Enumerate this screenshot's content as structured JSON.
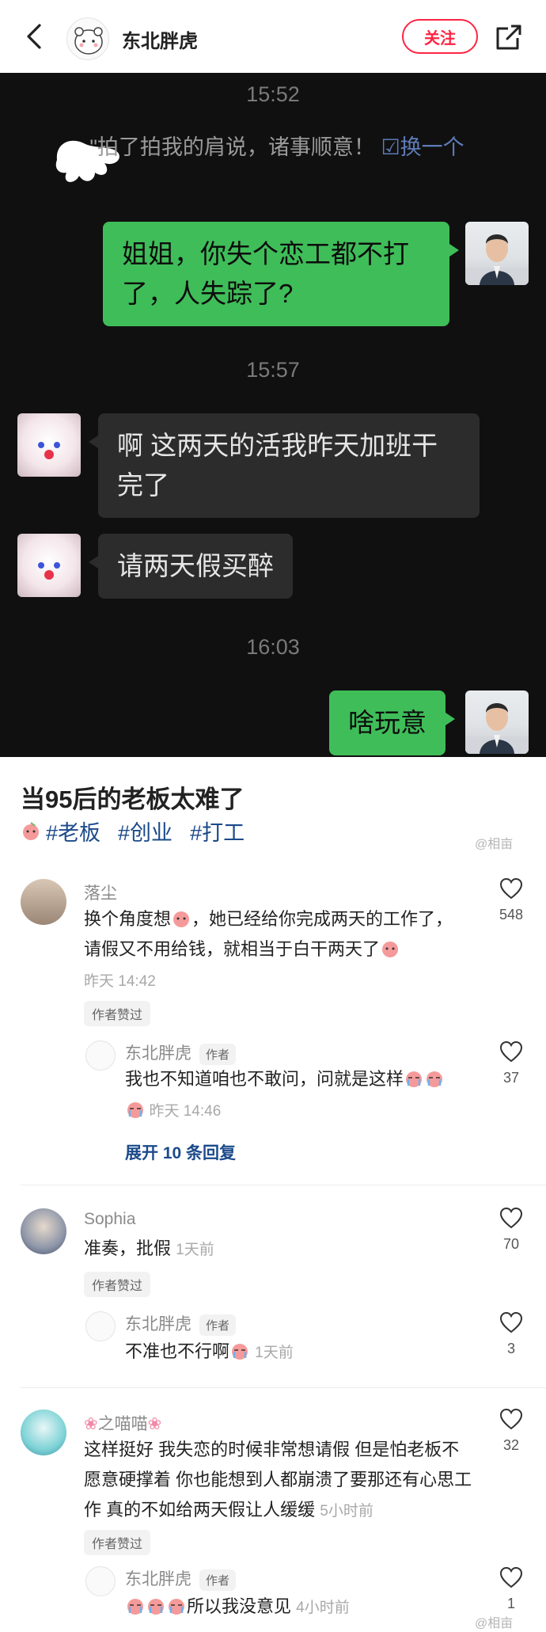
{
  "header": {
    "author_name": "东北胖虎",
    "follow_label": "关注",
    "icons": {
      "back": "back-arrow-icon",
      "share": "share-icon"
    }
  },
  "chat": {
    "times": [
      "15:52",
      "15:57",
      "16:03"
    ],
    "system_text": "\"拍了拍我的肩说，诸事顺意！",
    "system_link": "☑换一个",
    "messages": [
      {
        "from": "me",
        "text": "姐姐，你失个恋工都不打了，人失踪了?"
      },
      {
        "from": "them",
        "text": "啊 这两天的活我昨天加班干完了"
      },
      {
        "from": "them",
        "text": "请两天假买醉"
      },
      {
        "from": "me",
        "text": "啥玩意"
      }
    ]
  },
  "post": {
    "title": "当95后的老板太难了",
    "tags": [
      "#老板",
      "#创业",
      "#打工"
    ],
    "watermark": "@相亩"
  },
  "comments": [
    {
      "name": "落尘",
      "text_a": "换个角度想",
      "text_b": "，她已经给你完成两天的工作了，请假又不用给钱，就相当于白干两天了",
      "time": "昨天 14:42",
      "badge": "作者赞过",
      "likes": "548",
      "reply": {
        "name": "东北胖虎",
        "author_tag": "作者",
        "text": "我也不知道咱也不敢问，问就是这样",
        "time": "昨天 14:46",
        "likes": "37"
      },
      "expand": "展开 10 条回复"
    },
    {
      "name": "Sophia",
      "text": "准奏，批假",
      "time": "1天前",
      "badge": "作者赞过",
      "likes": "70",
      "reply": {
        "name": "东北胖虎",
        "author_tag": "作者",
        "text": "不准也不行啊",
        "time": "1天前",
        "likes": "3"
      }
    },
    {
      "name": "之喵喵",
      "text": "这样挺好 我失恋的时候非常想请假 但是怕老板不愿意硬撑着 你也能想到人都崩溃了要那还有心思工作 真的不如给两天假让人缓缓",
      "time": "5小时前",
      "badge": "作者赞过",
      "likes": "32",
      "reply": {
        "name": "东北胖虎",
        "author_tag": "作者",
        "text": "所以我没意见",
        "time": "4小时前",
        "likes": "1"
      }
    }
  ],
  "colors": {
    "accent": "#ff2442",
    "link": "#1b4a8a",
    "bubble_me": "#3fbd59",
    "bubble_them": "#2c2c2c"
  }
}
